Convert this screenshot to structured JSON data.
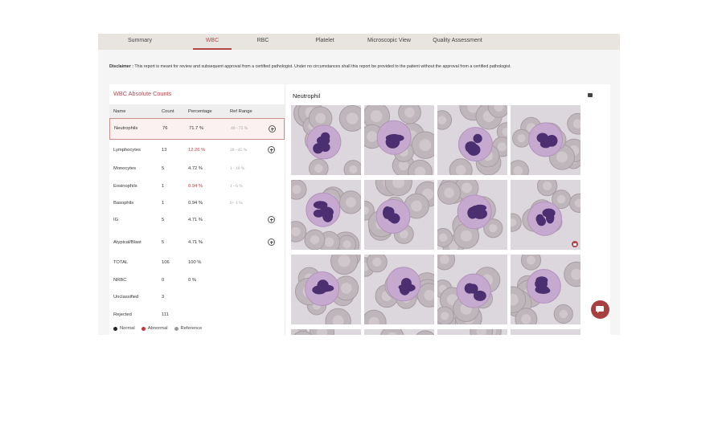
{
  "tabs": [
    {
      "label": "Summary",
      "active": false
    },
    {
      "label": "WBC",
      "active": true
    },
    {
      "label": "RBC",
      "active": false
    },
    {
      "label": "Platelet",
      "active": false
    },
    {
      "label": "Microscopic View",
      "active": false
    },
    {
      "label": "Quality Assessment",
      "active": false
    }
  ],
  "disclaimer": {
    "label": "Disclaimer :",
    "text": "This report is meant for review and subsequent approval from a certified pathologist. Under no circumstances shall this report be provided to the patient without the approval from a certified pathologist."
  },
  "wbc_panel": {
    "title": "WBC Absolute Counts",
    "headers": [
      "Name",
      "Count",
      "Percentage",
      "Ref Range"
    ],
    "rows": [
      {
        "name": "Neutrophils",
        "count": "76",
        "percentage": "71.7 %",
        "ref": "40 - 75 %",
        "status": "normal",
        "expandable": true,
        "selected": true
      },
      {
        "name": "Lymphocytes",
        "count": "13",
        "percentage": "12.26 %",
        "ref": "20 - 45 %",
        "status": "abnormal",
        "expandable": true,
        "selected": false
      },
      {
        "name": "Monocytes",
        "count": "5",
        "percentage": "4.72 %",
        "ref": "1 - 10 %",
        "status": "normal",
        "expandable": false,
        "selected": false
      },
      {
        "name": "Eosinophils",
        "count": "1",
        "percentage": "0.94 %",
        "ref": "1 - 6 %",
        "status": "abnormal",
        "expandable": false,
        "selected": false
      },
      {
        "name": "Basophils",
        "count": "1",
        "percentage": "0.94 %",
        "ref": "0 - 1 %",
        "status": "normal",
        "expandable": false,
        "selected": false
      },
      {
        "name": "IG",
        "count": "5",
        "percentage": "4.71 %",
        "ref": "",
        "status": "normal",
        "expandable": true,
        "selected": false
      },
      {
        "name": "Atypical/Blast",
        "count": "5",
        "percentage": "4.71 %",
        "ref": "",
        "status": "normal",
        "expandable": true,
        "selected": false
      },
      {
        "name": "TOTAL",
        "count": "106",
        "percentage": "100 %",
        "ref": "",
        "status": "normal",
        "expandable": false,
        "selected": false
      },
      {
        "name": "NRBC",
        "count": "0",
        "percentage": "0 %",
        "ref": "",
        "status": "normal",
        "expandable": false,
        "selected": false
      },
      {
        "name": "Unclassified",
        "count": "3",
        "percentage": "",
        "ref": "",
        "status": "normal",
        "expandable": false,
        "selected": false
      },
      {
        "name": "Rejected",
        "count": "111",
        "percentage": "",
        "ref": "",
        "status": "normal",
        "expandable": false,
        "selected": false
      }
    ],
    "legend": [
      {
        "label": "Normal",
        "color": "#222222"
      },
      {
        "label": "Abnormal",
        "color": "#c0393b"
      },
      {
        "label": "Reference",
        "color": "#9a9a9a"
      }
    ]
  },
  "gallery": {
    "title": "Neutrophil",
    "icons": {
      "header": "camera-icon",
      "chat": "chat-icon",
      "badge": "image-flag-icon"
    },
    "images": [
      {
        "flagged": false
      },
      {
        "flagged": false
      },
      {
        "flagged": false
      },
      {
        "flagged": false
      },
      {
        "flagged": false
      },
      {
        "flagged": false
      },
      {
        "flagged": false
      },
      {
        "flagged": true
      },
      {
        "flagged": false
      },
      {
        "flagged": false
      },
      {
        "flagged": false
      },
      {
        "flagged": false
      },
      {
        "flagged": false
      },
      {
        "flagged": false
      },
      {
        "flagged": false
      },
      {
        "flagged": false
      }
    ]
  },
  "colors": {
    "accent": "#b4464a",
    "abnormal": "#c0393b",
    "chat_button": "#a8403f"
  }
}
